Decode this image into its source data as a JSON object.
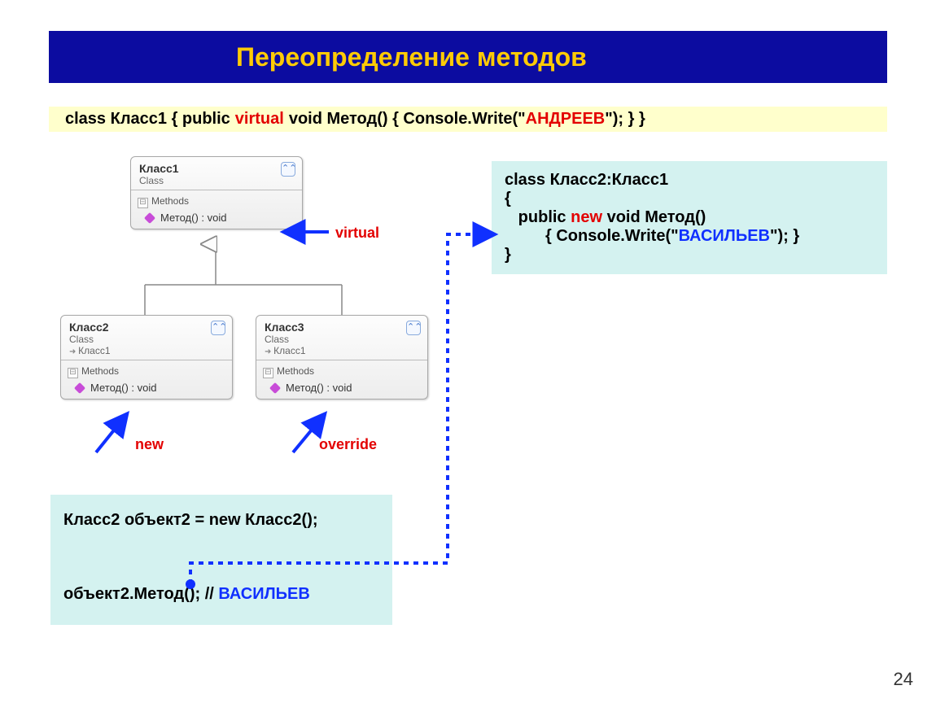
{
  "title": "Переопределение методов",
  "code_strip": {
    "pre": "class Класс1  {   public ",
    "virtual": "virtual",
    "mid": " void Метод() { Console.Write(\"",
    "str": "АНДРЕЕВ",
    "post": "\"); }   }"
  },
  "uml": {
    "class1": {
      "name": "Класс1",
      "sub": "Class",
      "section": "Methods",
      "method": "Метод() : void"
    },
    "class2": {
      "name": "Класс2",
      "sub": "Class",
      "parent": "Класс1",
      "section": "Methods",
      "method": "Метод() : void"
    },
    "class3": {
      "name": "Класс3",
      "sub": "Class",
      "parent": "Класс1",
      "section": "Methods",
      "method": "Метод() : void"
    }
  },
  "labels": {
    "virtual": "virtual",
    "new": "new",
    "override": "override"
  },
  "code_right": {
    "l1": "class Класс2:Класс1",
    "l2": "{",
    "l3a": "   public ",
    "l3b": "new",
    "l3c": " void Метод()",
    "l4a": "         { Console.Write(\"",
    "l4b": "ВАСИЛЬЕВ",
    "l4c": "\"); }",
    "l5": "}"
  },
  "code_bottom": {
    "l1": "Класс2 объект2 = new Класс2();",
    "l2a": "объект2.Метод();  // ",
    "l2b": "ВАСИЛЬЕВ"
  },
  "page": "24"
}
